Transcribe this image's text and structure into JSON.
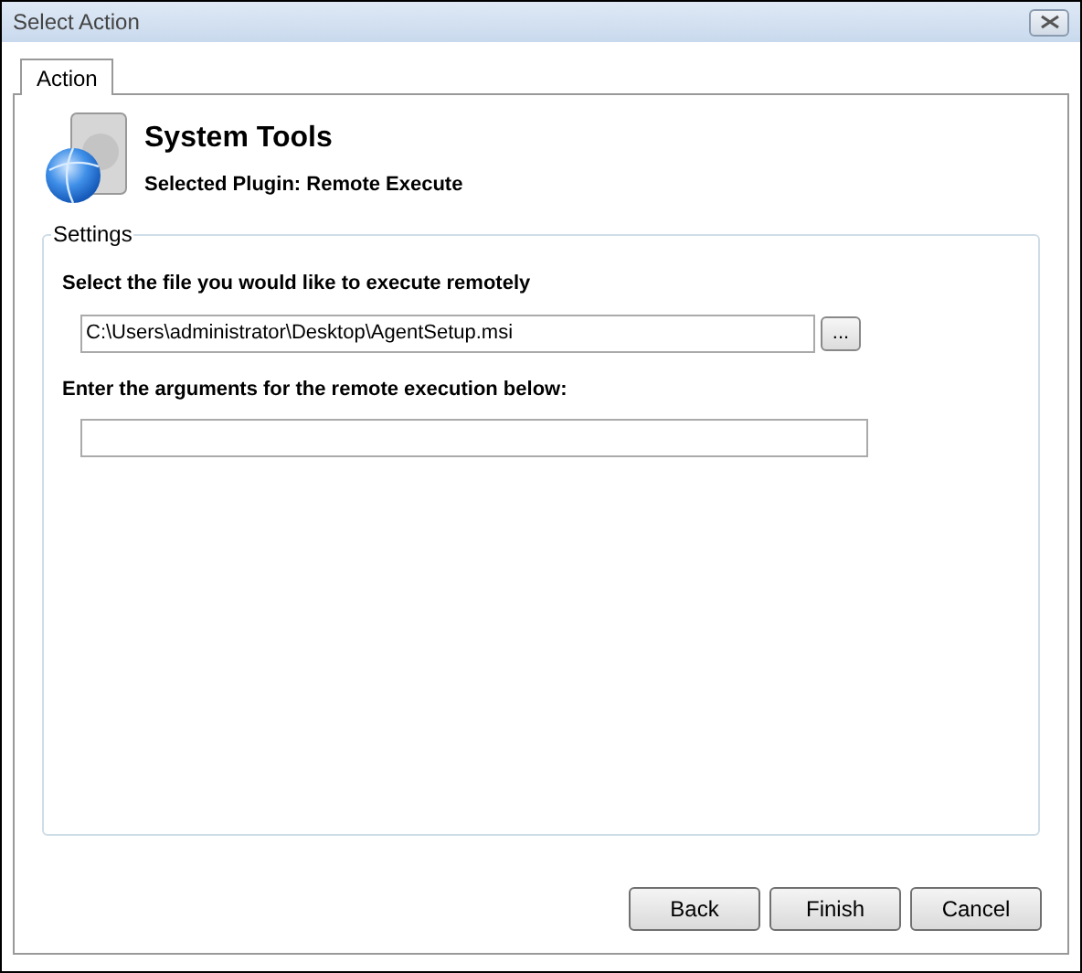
{
  "window": {
    "title": "Select Action"
  },
  "tabs": [
    {
      "label": "Action",
      "selected": true
    }
  ],
  "header": {
    "title": "System Tools",
    "subtitle": "Selected Plugin: Remote Execute"
  },
  "settings": {
    "legend": "Settings",
    "file_label": "Select the file you would like to execute remotely",
    "file_value": "C:\\Users\\administrator\\Desktop\\AgentSetup.msi",
    "browse_button": "...",
    "args_label": "Enter the arguments for the remote execution below:"
  },
  "buttons": [
    "Back",
    "Finish",
    "Cancel"
  ]
}
